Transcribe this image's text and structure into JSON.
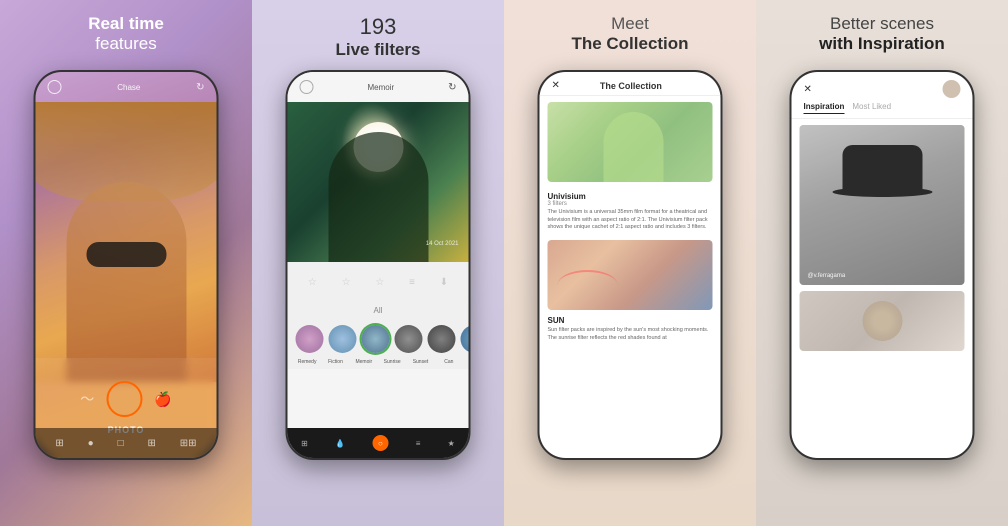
{
  "panels": [
    {
      "id": "panel-1",
      "header_line1": "Real time",
      "header_line2": "features",
      "phone": {
        "topbar_label": "Chase",
        "mode_label": "PHOTO",
        "bottom_items": [
          "⊞",
          "●",
          "☁",
          "☰",
          "⊞⊞"
        ]
      }
    },
    {
      "id": "panel-2",
      "header_count": "193",
      "header_subtitle": "Live filters",
      "phone": {
        "topbar_label": "Memoir",
        "date_text": "14 Oct 2021",
        "filters_label": "All",
        "filter_names": [
          "Remedy",
          "Fiction",
          "Memoir",
          "Sunrise",
          "Sunset",
          "Can"
        ],
        "bottom_items": [
          "⊞",
          "●",
          "○",
          "≡",
          "★"
        ]
      }
    },
    {
      "id": "panel-3",
      "header_meet": "Meet",
      "header_collection": "The Collection",
      "phone": {
        "title": "The Collection",
        "item1_name": "Univisium",
        "item1_count": "3 filters",
        "item1_desc": "The Univisium is a universal 35mm film format for a theatrical and television film with an aspect ratio of 2:1. The Univisium filter pack shows the unique cachet of 2:1 aspect ratio and includes 3 filters.",
        "item2_name": "SUN",
        "item2_desc": "Sun filter packs are inspired by the sun's most shocking moments. The sunrise filter reflects the red shades found at"
      }
    },
    {
      "id": "panel-4",
      "header_better": "Better scenes",
      "header_with": "with",
      "header_inspiration": "Inspiration",
      "phone": {
        "tab_active": "Inspiration",
        "tab_inactive": "Most Liked",
        "username": "@v.ferragama"
      }
    }
  ]
}
